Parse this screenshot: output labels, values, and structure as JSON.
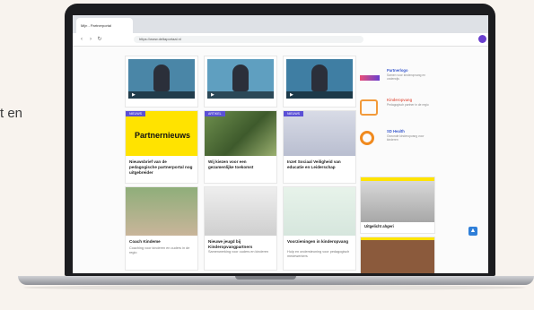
{
  "side_text": "t en",
  "browser": {
    "tab_title": "Mijn - Partnerportal",
    "url": "https://www.deltaportaal.nl"
  },
  "feed": {
    "videos": [
      {
        "id": "v1"
      },
      {
        "id": "v2"
      },
      {
        "id": "v3"
      }
    ],
    "row2": [
      {
        "badge": "NIEUWS",
        "title": "Nieuwsbrief van de pedagogische partnerportal nog uitgebreider",
        "banner": "Partnernieuws"
      },
      {
        "badge": "ARTIKEL",
        "title": "Wij kiezen voor een gezamenlijke toekomst"
      },
      {
        "badge": "NIEUWS",
        "title": "Inzet Sociaal Veiligheid van educatie en Leiderschap"
      }
    ],
    "row3": [
      {
        "title": "Coach Kindeme",
        "desc": "Coaching voor kinderen en ouders in de regio"
      },
      {
        "title": "Nieuwe jeugd bij Kinderopvangpartners",
        "desc": "Samenwerking voor ouders en kinderen"
      },
      {
        "title": "Voorzieningen in kinderopvang",
        "desc": "Hulp en ondersteuning voor pedagogisch medewerkers"
      }
    ]
  },
  "sidebar": {
    "partners": [
      {
        "name": "Partnerlogo",
        "desc": "Samen voor kinderopvang en onderwijs"
      },
      {
        "name": "Kinderopvang",
        "desc": "Pedagogisch partner in de regio"
      },
      {
        "name": "SD Health",
        "desc": "Gezonde kinderopvang voor kinderen"
      }
    ],
    "feature_title": "Uitgelicht ahgeri"
  },
  "colors": {
    "accent": "#5b50d6",
    "yellow": "#ffe300",
    "fab": "#2f7fd8"
  }
}
